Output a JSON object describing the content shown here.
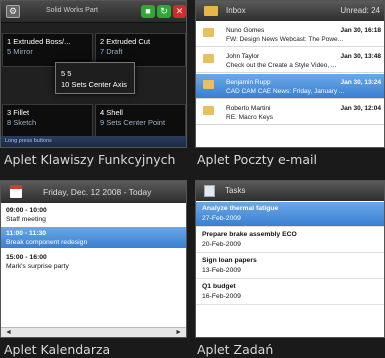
{
  "function_keys": {
    "title": "Solid Works Part",
    "buttons": [
      {
        "icon": "green-square-icon",
        "color": "#2fa838"
      },
      {
        "icon": "green-arrow-icon",
        "color": "#2fa838"
      },
      {
        "icon": "red-close-icon",
        "color": "#d42a2a"
      }
    ],
    "cells": [
      {
        "num": "1",
        "label": "Extruded Boss/...",
        "sub_num": "5",
        "sub": "Mirror"
      },
      {
        "num": "2",
        "label": "Extruded Cut",
        "sub_num": "7",
        "sub": "Draft"
      },
      {
        "num": "3",
        "label": "Fillet",
        "sub_num": "8",
        "sub": "Sketch"
      },
      {
        "num": "4",
        "label": "Shell",
        "sub_num": "9",
        "sub": "Sets Center Point"
      }
    ],
    "overlay": {
      "line1_num": "5",
      "line1": "5",
      "line2_num": "10",
      "line2": "Sets Center Axis"
    },
    "footer": "Long press buttons",
    "caption": "Aplet Klawiszy Funkcyjnych"
  },
  "mail": {
    "title": "Inbox",
    "unread": "Unread: 24",
    "rows": [
      {
        "from": "Nuno Gomes",
        "date": "Jan 30, 16:18",
        "subject": "FW: Design News Webcast: The Powe...",
        "icon_color": "#e8c060"
      },
      {
        "from": "John Taylor",
        "date": "Jan 30, 13:48",
        "subject": "Check out the Create a Style Video, ...",
        "icon_color": "#e8c060"
      },
      {
        "from": "Benjamin Rupp",
        "date": "Jan 30, 13:24",
        "subject": "CAD CAM CAE News: Friday, January ...",
        "icon_color": "#e8c060"
      },
      {
        "from": "Roberto Martini",
        "date": "Jan 30, 12:04",
        "subject": "RE: Macro Keys",
        "icon_color": "#e8c060"
      }
    ],
    "selected_index": 2,
    "caption": "Aplet Poczty e-mail"
  },
  "calendar": {
    "title": "Friday, Dec. 12 2008 - Today",
    "events": [
      {
        "time": "09:00 - 10:00",
        "title": "Staff meeting"
      },
      {
        "time": "11:00 - 11:30",
        "title": "Break component redesign"
      },
      {
        "time": "15:00 - 16:00",
        "title": "Mark's surprise party"
      }
    ],
    "selected_index": 1,
    "arrow_left": "◄",
    "arrow_right": "►",
    "caption": "Aplet Kalendarza"
  },
  "tasks": {
    "title": "Tasks",
    "items": [
      {
        "name": "Analyze thermal fatigue",
        "date": "27-Feb-2009"
      },
      {
        "name": "Prepare brake assembly ECO",
        "date": "20-Feb-2009"
      },
      {
        "name": "Sign loan papers",
        "date": "13-Feb-2009"
      },
      {
        "name": "Q1 budget",
        "date": "16-Feb-2009"
      }
    ],
    "selected_index": 0,
    "caption": "Aplet Zadań"
  }
}
